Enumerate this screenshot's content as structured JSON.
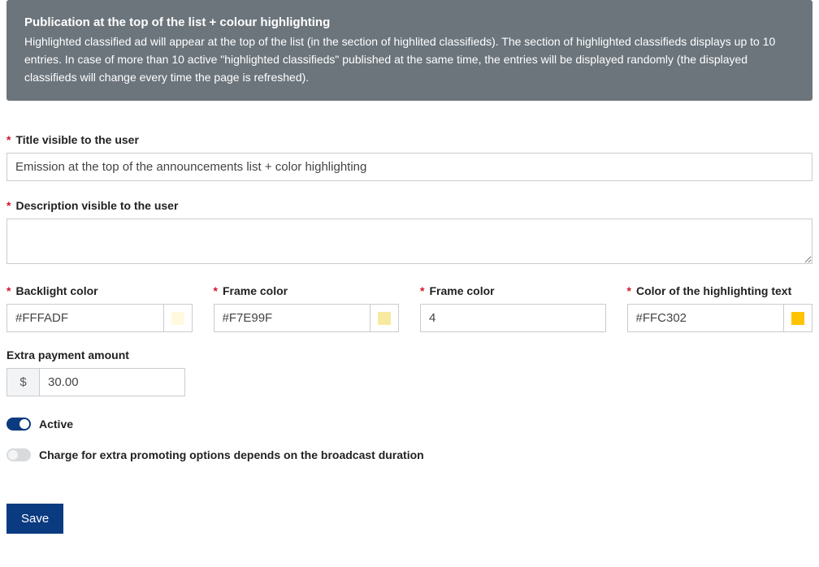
{
  "info": {
    "title": "Publication at the top of the list + colour highlighting",
    "body": "Highlighted classified ad will appear at the top of the list (in the section of highlited classifieds). The section of highlighted classifieds displays up to 10 entries. In case of more than 10 active \"highlighted classifieds\" published at the same time, the entries will be displayed randomly (the displayed classifieds will change every time the page is refreshed)."
  },
  "fields": {
    "title": {
      "label": "Title visible to the user",
      "value": "Emission at the top of the announcements list + color highlighting"
    },
    "description": {
      "label": "Description visible to the user",
      "value": ""
    },
    "backlight": {
      "label": "Backlight color",
      "value": "#FFFADF",
      "swatch": "#FFFADF"
    },
    "frame": {
      "label": "Frame color",
      "value": "#F7E99F",
      "swatch": "#F7E99F"
    },
    "frame2": {
      "label": "Frame color",
      "value": "4"
    },
    "textcolor": {
      "label": "Color of the highlighting text",
      "value": "#FFC302",
      "swatch": "#FFC302"
    },
    "amount": {
      "label": "Extra payment amount",
      "prefix": "$",
      "value": "30.00"
    }
  },
  "toggles": {
    "active": {
      "label": "Active",
      "on": true
    },
    "charge": {
      "label": "Charge for extra promoting options depends on the broadcast duration",
      "on": false
    }
  },
  "buttons": {
    "save": "Save"
  }
}
